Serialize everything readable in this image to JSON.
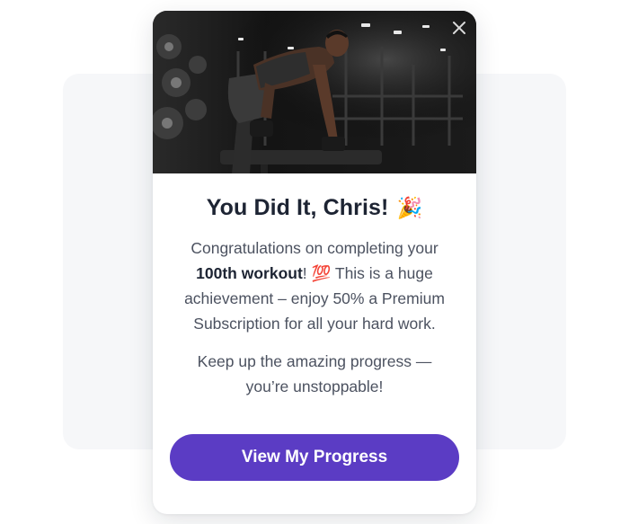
{
  "modal": {
    "title": "You Did It, Chris!",
    "title_emoji": "🎉",
    "body_part1": "Congratulations on completing your ",
    "body_bold": "100th workout",
    "body_part2": "! ",
    "body_emoji": "💯",
    "body_part3": " This is a huge achievement – enjoy 50% a Premium Subscription for all your hard work.",
    "body2": "Keep up the amazing progress — you’re unstoppable!",
    "cta_label": "View My Progress",
    "close_icon": "close-icon",
    "hero_image": "gym-workout-photo"
  },
  "colors": {
    "accent": "#5b3cc4",
    "title": "#1d2433",
    "body": "#4c5260",
    "backdrop": "#f6f7f9"
  }
}
